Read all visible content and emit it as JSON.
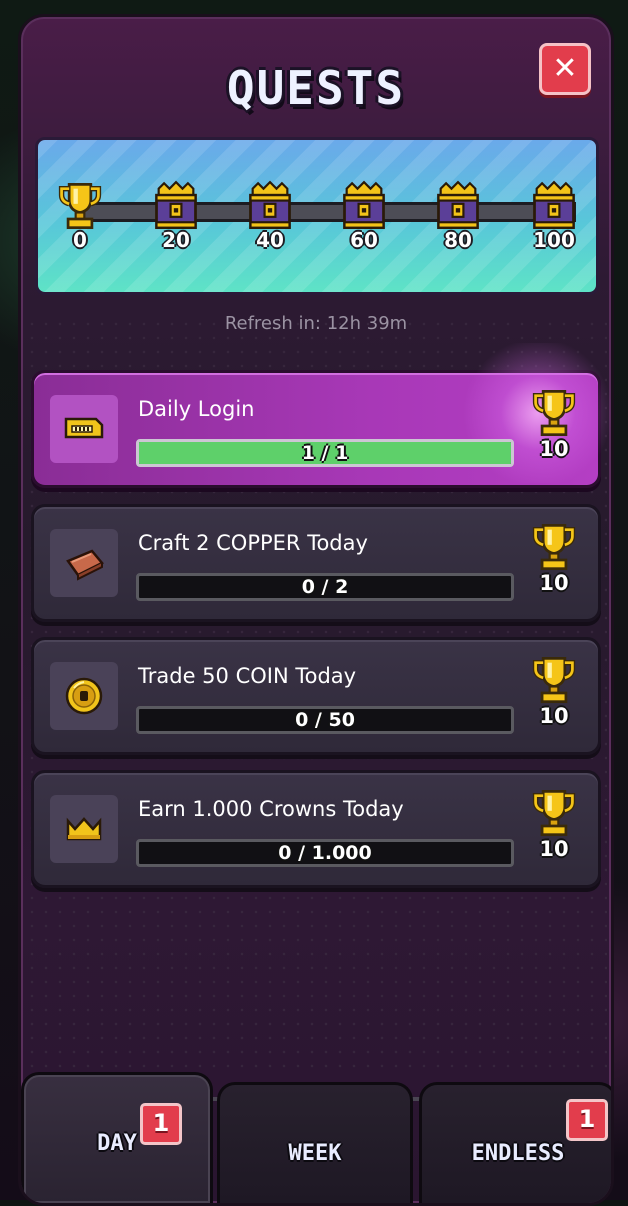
{
  "header": {
    "title": "QUESTS",
    "close_icon": "close-x-icon"
  },
  "milestones": [
    {
      "label": "0",
      "icon": "trophy-icon"
    },
    {
      "label": "20",
      "icon": "chest-icon"
    },
    {
      "label": "40",
      "icon": "chest-icon"
    },
    {
      "label": "60",
      "icon": "chest-icon"
    },
    {
      "label": "80",
      "icon": "chest-icon"
    },
    {
      "label": "100",
      "icon": "chest-icon"
    }
  ],
  "refresh": {
    "text": "Refresh in: 12h 39m"
  },
  "quests": [
    {
      "title": "Daily Login",
      "progress_text": "1 / 1",
      "progress": 1.0,
      "reward": "10",
      "icon": "ticket-icon",
      "completed": true
    },
    {
      "title": "Craft 2 COPPER Today",
      "progress_text": "0 / 2",
      "progress": 0,
      "reward": "10",
      "icon": "copper-bar-icon",
      "completed": false
    },
    {
      "title": "Trade 50 COIN Today",
      "progress_text": "0 / 50",
      "progress": 0,
      "reward": "10",
      "icon": "coin-icon",
      "completed": false
    },
    {
      "title": "Earn 1.000 Crowns Today",
      "progress_text": "0 / 1.000",
      "progress": 0,
      "reward": "10",
      "icon": "crown-icon",
      "completed": false
    }
  ],
  "tabs": [
    {
      "label": "DAY",
      "badge": "1",
      "active": true
    },
    {
      "label": "WEEK",
      "badge": "",
      "active": false
    },
    {
      "label": "ENDLESS",
      "badge": "1",
      "active": false
    }
  ],
  "colors": {
    "accent": "#a838b7",
    "progress_fill": "#5ed06a",
    "badge": "#e23d4c"
  }
}
